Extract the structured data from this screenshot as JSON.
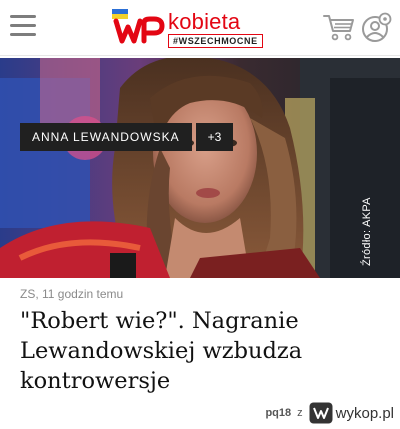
{
  "header": {
    "brand_name": "kobieta",
    "brand_tag": "#WSZECHMOCNE",
    "colors": {
      "brand_red": "#e30613",
      "icon_gray": "#7d7d7d"
    },
    "icons": [
      "hamburger-menu-icon",
      "wp-logo-icon",
      "shopping-cart-icon",
      "user-settings-icon"
    ]
  },
  "article": {
    "tags": [
      {
        "label": "ANNA LEWANDOWSKA"
      },
      {
        "label": "+3"
      }
    ],
    "photo_source": "Źródło: AKPA",
    "meta": "ZS, 11 godzin temu",
    "headline": "\"Robert wie?\". Nagranie Lewandowskiej wzbudza kontrowersje"
  },
  "watermark": {
    "user": "pq18",
    "separator": "z",
    "site": "wykop.pl"
  }
}
